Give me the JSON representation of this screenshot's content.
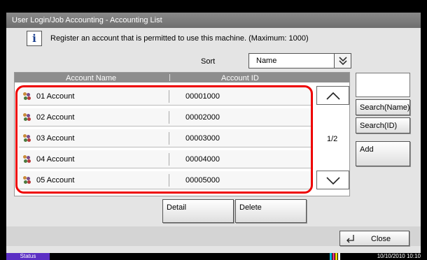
{
  "window": {
    "title": "User Login/Job Accounting - Accounting List"
  },
  "info": {
    "text": "Register an account that is permitted to use this machine. (Maximum: 1000)"
  },
  "sort": {
    "label": "Sort",
    "value": "Name"
  },
  "list": {
    "columns": [
      "Account Name",
      "Account ID"
    ],
    "rows": [
      {
        "name": "01  Account",
        "id": "00001000"
      },
      {
        "name": "02  Account",
        "id": "00002000"
      },
      {
        "name": "03  Account",
        "id": "00003000"
      },
      {
        "name": "04  Account",
        "id": "00004000"
      },
      {
        "name": "05  Account",
        "id": "00005000"
      }
    ],
    "page": "1/2"
  },
  "side_buttons": {
    "search_name": "Search(Name)",
    "search_id": "Search(ID)",
    "add": "Add"
  },
  "actions": {
    "detail": "Detail",
    "delete": "Delete",
    "close": "Close"
  },
  "status": {
    "tab": "Status",
    "datetime": "10/10/2010  10:10"
  },
  "colors": {
    "highlight": "#e00000",
    "status_tab": "#5b2fc4"
  }
}
